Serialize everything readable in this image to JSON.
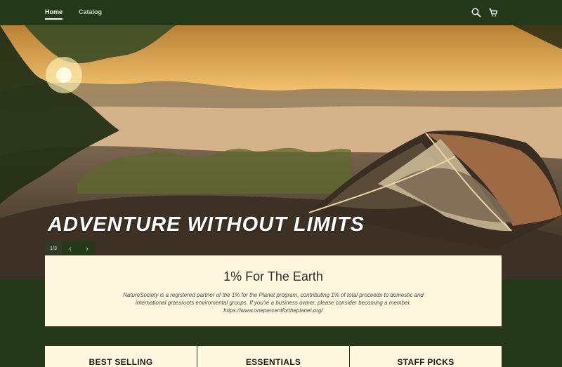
{
  "nav": {
    "items": [
      "Home",
      "Catalog"
    ],
    "search_icon": "search-icon",
    "cart_icon": "cart-icon"
  },
  "hero": {
    "title": "ADVENTURE WITHOUT LIMITS",
    "slide_count": "1/3",
    "prev_icon": "chevron-left-icon",
    "next_icon": "chevron-right-icon"
  },
  "info": {
    "title": "1% For The Earth",
    "body": "NatureSociety is a registered partner of the 1% for the Planet program, contributing 1% of total proceeds to domestic and international grassroots enviromental groups. If you're a business owner, please consider becoming a member. https://www.onepercentfortheplanet.org/"
  },
  "categories": [
    "BEST SELLING",
    "ESSENTIALS",
    "STAFF PICKS"
  ]
}
